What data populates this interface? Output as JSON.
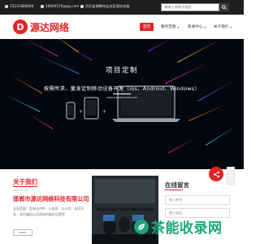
{
  "topbar": {
    "phone": "15231888669",
    "email": "18646570@qq.com",
    "address": "河北省邯郸市丛台区联纺东路",
    "search_placeholder": "请输入关键字搜索"
  },
  "header": {
    "logo_mark": "D",
    "logo_text": "源达网络"
  },
  "nav": {
    "items": [
      {
        "label": "首页"
      },
      {
        "label": "服务范围"
      },
      {
        "label": "新闻中心"
      },
      {
        "label": "关于我们"
      }
    ]
  },
  "hero": {
    "title": "项目定制",
    "subtitle": "按需所求、量身定制移动设备开发（ios、Android、Windows）",
    "url": "www.handancaiqi.com"
  },
  "about": {
    "title": "关于我们",
    "subtitle_en": "ABOUT US",
    "company": "邯郸市源达网络科技有限公司",
    "description": "业务范围：定制化APP、小程序、公众号、网页开发，软件编程以及网站的维护运营等",
    "more_label": "more"
  },
  "message": {
    "title": "在线留言",
    "name_placeholder": "输入姓名",
    "phone_placeholder": "输入电话"
  },
  "watermark": {
    "text": "茶能收录网"
  },
  "colors": {
    "brand_red": "#e02424",
    "topbar_bg": "#1e1e1e",
    "hero_bg": "#04070f",
    "watermark_green": "#1aa776"
  }
}
